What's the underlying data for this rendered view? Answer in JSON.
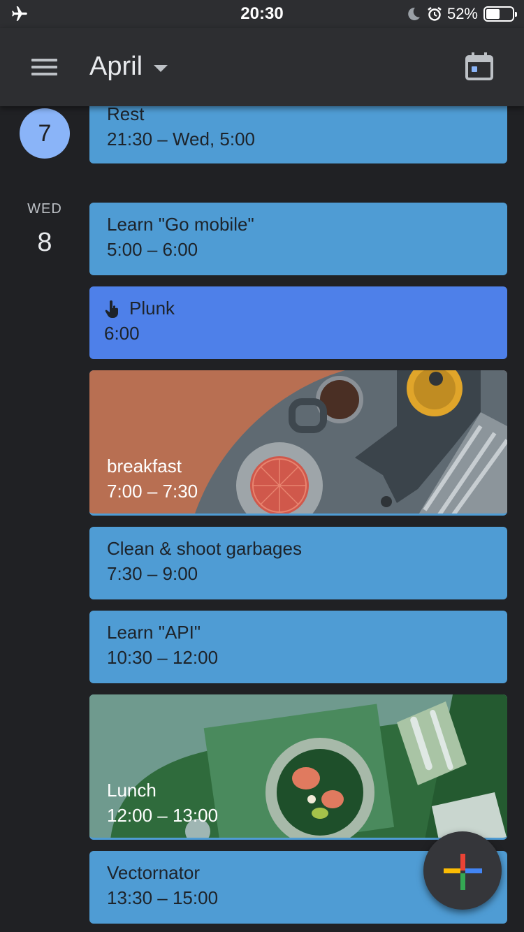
{
  "status_bar": {
    "time": "20:30",
    "battery_percent": "52%",
    "battery_level": 0.52,
    "icons": [
      "airplane-mode-icon",
      "moon-icon",
      "alarm-icon",
      "battery-icon"
    ]
  },
  "app_bar": {
    "month_label": "April",
    "menu_icon": "hamburger-menu-icon",
    "today_icon": "calendar-today-icon"
  },
  "days": [
    {
      "date_number": "7"
    },
    {
      "weekday": "WED",
      "date_number": "8"
    }
  ],
  "events": [
    {
      "title": "Rest",
      "time": "21:30 – Wed, 5:00",
      "color": "#4f9cd4"
    },
    {
      "title": "Learn \"Go mobile\"",
      "time": "5:00 – 6:00",
      "color": "#4f9cd4"
    },
    {
      "title": "Plunk",
      "time": "6:00",
      "icon": "hand-pointer-icon",
      "color": "#4e80e9"
    },
    {
      "title": "breakfast",
      "time": "7:00 – 7:30",
      "illustration": "breakfast-illustration"
    },
    {
      "title": "Clean & shoot garbages",
      "time": "7:30 – 9:00",
      "color": "#4f9cd4"
    },
    {
      "title": "Learn \"API\"",
      "time": "10:30 – 12:00",
      "color": "#4f9cd4"
    },
    {
      "title": "Lunch",
      "time": "12:00 – 13:00",
      "illustration": "lunch-illustration"
    },
    {
      "title": "Vectornator",
      "time": "13:30 – 15:00",
      "color": "#4f9cd4"
    }
  ],
  "fab": {
    "icon": "plus-icon",
    "colors": [
      "#ea4335",
      "#4285f4",
      "#fbbc04",
      "#34a853"
    ]
  }
}
